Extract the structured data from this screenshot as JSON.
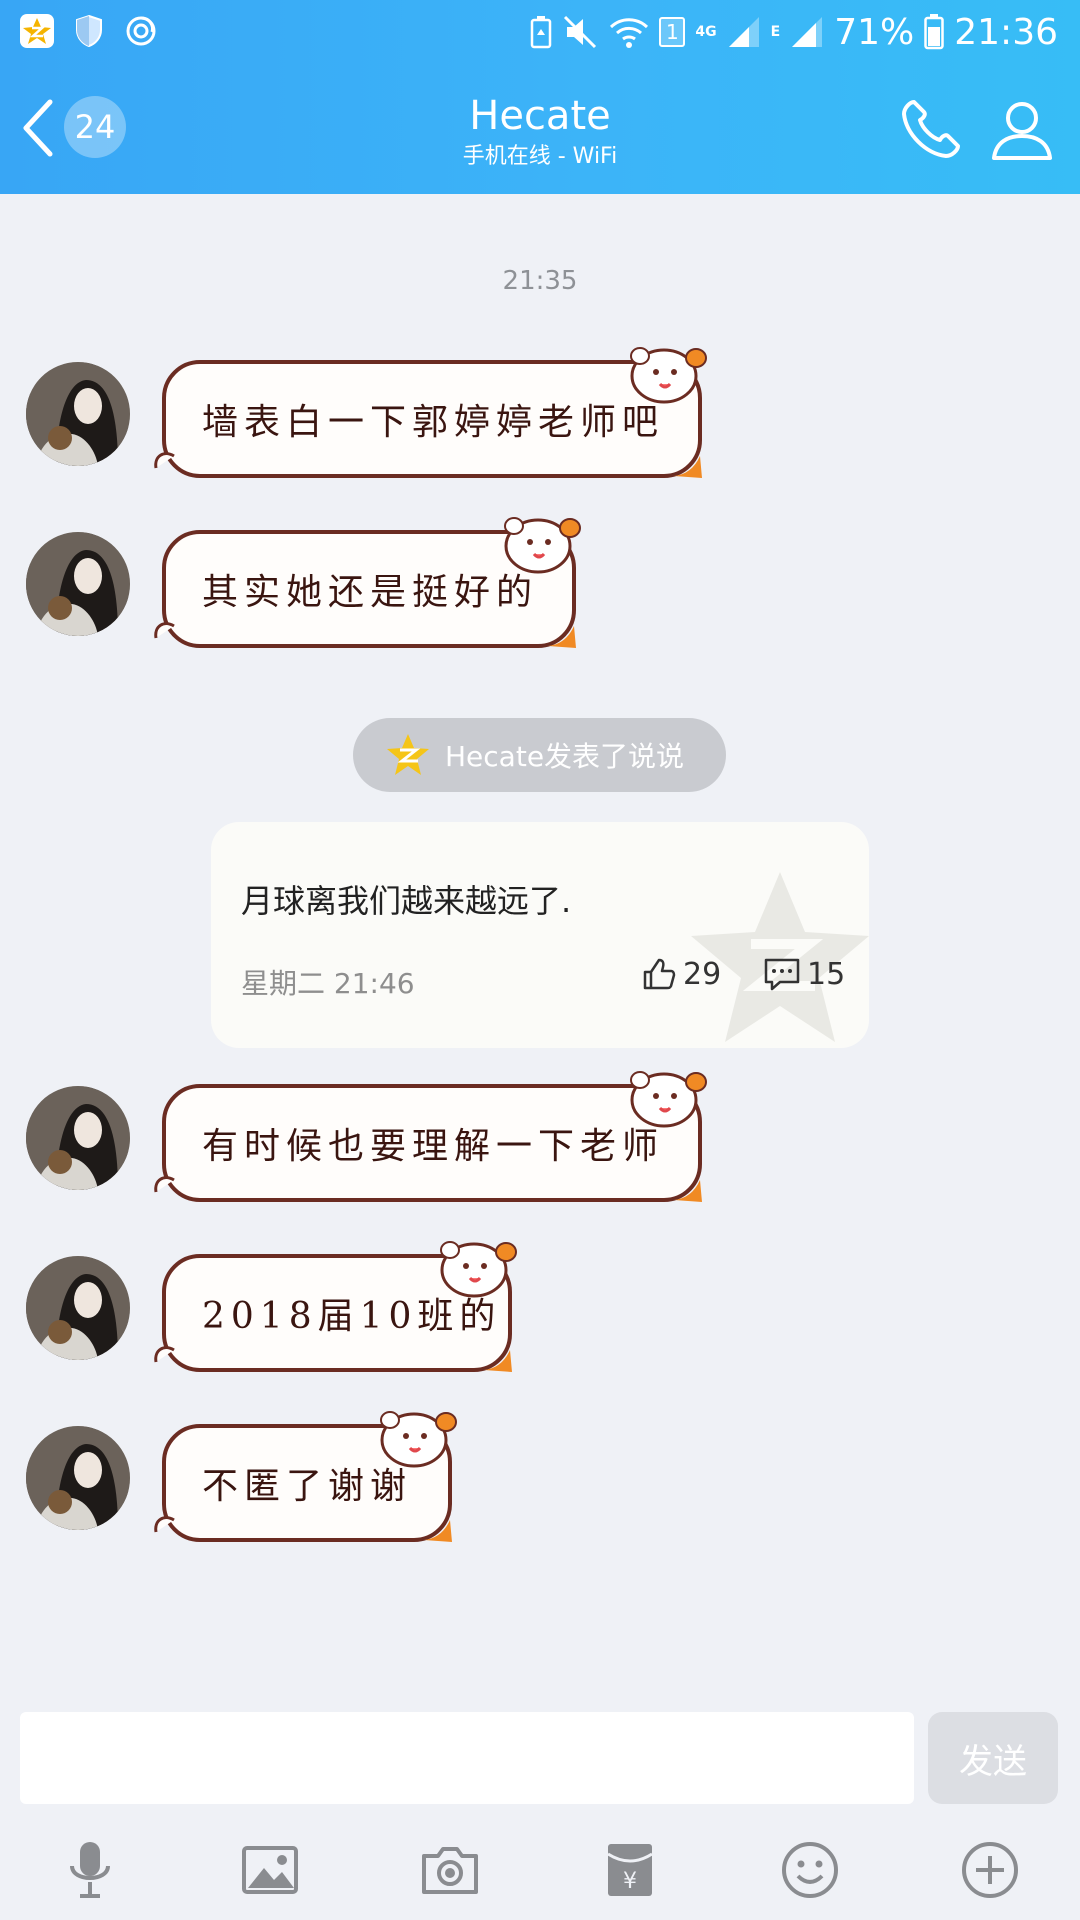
{
  "status_bar": {
    "network_4g": "4G",
    "network_e": "E",
    "sim_slot": "1",
    "battery": "71%",
    "time": "21:36"
  },
  "header": {
    "unread_count": "24",
    "title": "Hecate",
    "subtitle": "手机在线 - WiFi"
  },
  "chat": {
    "timestamp": "21:35",
    "messages_top": [
      {
        "text": "墙表白一下郭婷婷老师吧"
      },
      {
        "text": "其实她还是挺好的"
      }
    ],
    "post_notice": "Hecate发表了说说",
    "post_card": {
      "text": "月球离我们越来越远了.",
      "time": "星期二 21:46",
      "likes": "29",
      "comments": "15"
    },
    "messages_bottom": [
      {
        "text": "有时候也要理解一下老师"
      },
      {
        "text": "2018届10班的"
      },
      {
        "text": "不匿了谢谢"
      }
    ]
  },
  "input": {
    "placeholder": "",
    "send_label": "发送"
  },
  "colors": {
    "header_blue": "#3cb4f8",
    "bubble_border": "#6b2c22",
    "chat_bg": "#eff1f6"
  }
}
